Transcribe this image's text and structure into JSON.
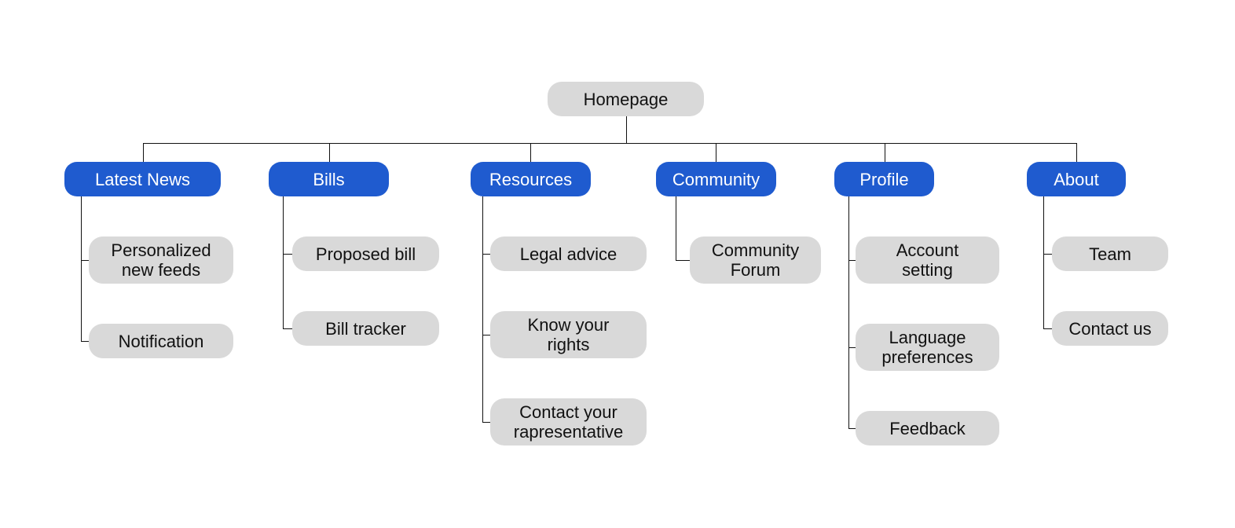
{
  "colors": {
    "section": "#1f5bcf",
    "node": "#d9d9d9",
    "connector": "#111111"
  },
  "root": {
    "label": "Homepage"
  },
  "sections": [
    {
      "label": "Latest News",
      "children": [
        {
          "label": "Personalized\nnew feeds"
        },
        {
          "label": "Notification"
        }
      ]
    },
    {
      "label": "Bills",
      "children": [
        {
          "label": "Proposed bill"
        },
        {
          "label": "Bill tracker"
        }
      ]
    },
    {
      "label": "Resources",
      "children": [
        {
          "label": "Legal advice"
        },
        {
          "label": "Know your\nrights"
        },
        {
          "label": "Contact your\nrapresentative"
        }
      ]
    },
    {
      "label": "Community",
      "children": [
        {
          "label": "Community\nForum"
        }
      ]
    },
    {
      "label": "Profile",
      "children": [
        {
          "label": "Account\nsetting"
        },
        {
          "label": "Language\npreferences"
        },
        {
          "label": "Feedback"
        }
      ]
    },
    {
      "label": "About",
      "children": [
        {
          "label": "Team"
        },
        {
          "label": "Contact us"
        }
      ]
    }
  ]
}
